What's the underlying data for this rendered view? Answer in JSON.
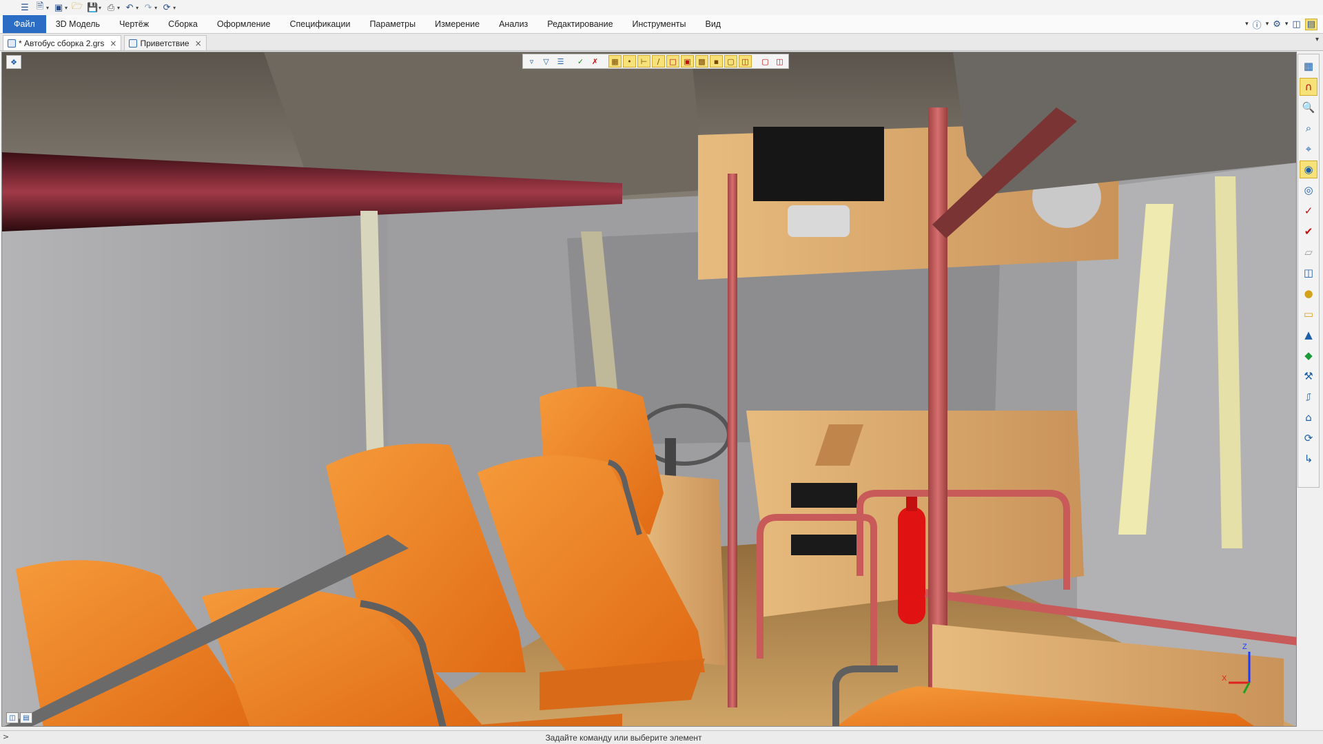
{
  "colors": {
    "accent": "#2b6cc4",
    "seat_orange": "#f07f26",
    "handrail_red": "#c85a5a",
    "wood": "#d8a86a",
    "extinguisher_red": "#e01212"
  },
  "quick_access": {
    "items": [
      {
        "icon": "menu-icon"
      },
      {
        "icon": "new-document-icon"
      },
      {
        "icon": "new-model-icon"
      },
      {
        "icon": "open-folder-icon"
      },
      {
        "icon": "save-icon"
      },
      {
        "icon": "print-icon"
      },
      {
        "icon": "undo-icon"
      },
      {
        "icon": "redo-icon"
      },
      {
        "icon": "rebuild-icon"
      }
    ]
  },
  "menu": {
    "items": [
      "Файл",
      "3D Модель",
      "Чертёж",
      "Сборка",
      "Оформление",
      "Спецификации",
      "Параметры",
      "Измерение",
      "Анализ",
      "Редактирование",
      "Инструменты",
      "Вид"
    ],
    "active_index": 0
  },
  "tabs": [
    {
      "label": "* Автобус сборка 2.grs",
      "active": true
    },
    {
      "label": "Приветствие",
      "active": false
    }
  ],
  "viewport": {
    "toolbar_icons": [
      "filter-icon",
      "filter-select-icon",
      "filter-list-icon",
      "select-check-icon",
      "deselect-icon",
      "grid-icon",
      "point-snap-icon",
      "axis-icon",
      "edge-icon",
      "face-icon",
      "body-icon",
      "solid-icon",
      "shaded-icon",
      "wire-icon",
      "hidden-icon",
      "view-3d-icon",
      "display-icon",
      "section-icon"
    ],
    "axis_labels": {
      "z": "Z",
      "x": "X"
    }
  },
  "right_toolbar": {
    "icons": [
      "view-layout-icon",
      "magnet-icon",
      "zoom-icon",
      "zoom-window-icon",
      "zoom-fit-icon",
      "glasses-icon",
      "glasses-settings-icon",
      "box-check-icon",
      "box-check2-icon",
      "plane-icon",
      "cube-wire-icon",
      "sphere-icon",
      "page-view-icon",
      "shape-icon",
      "color-box-icon",
      "tools-icon",
      "camera-icon",
      "home-view-icon",
      "rotate-view-icon",
      "export-view-icon"
    ],
    "active": [
      1,
      7
    ]
  },
  "status": {
    "prompt": "Задайте команду или выберите элемент",
    "arrow": ">"
  }
}
